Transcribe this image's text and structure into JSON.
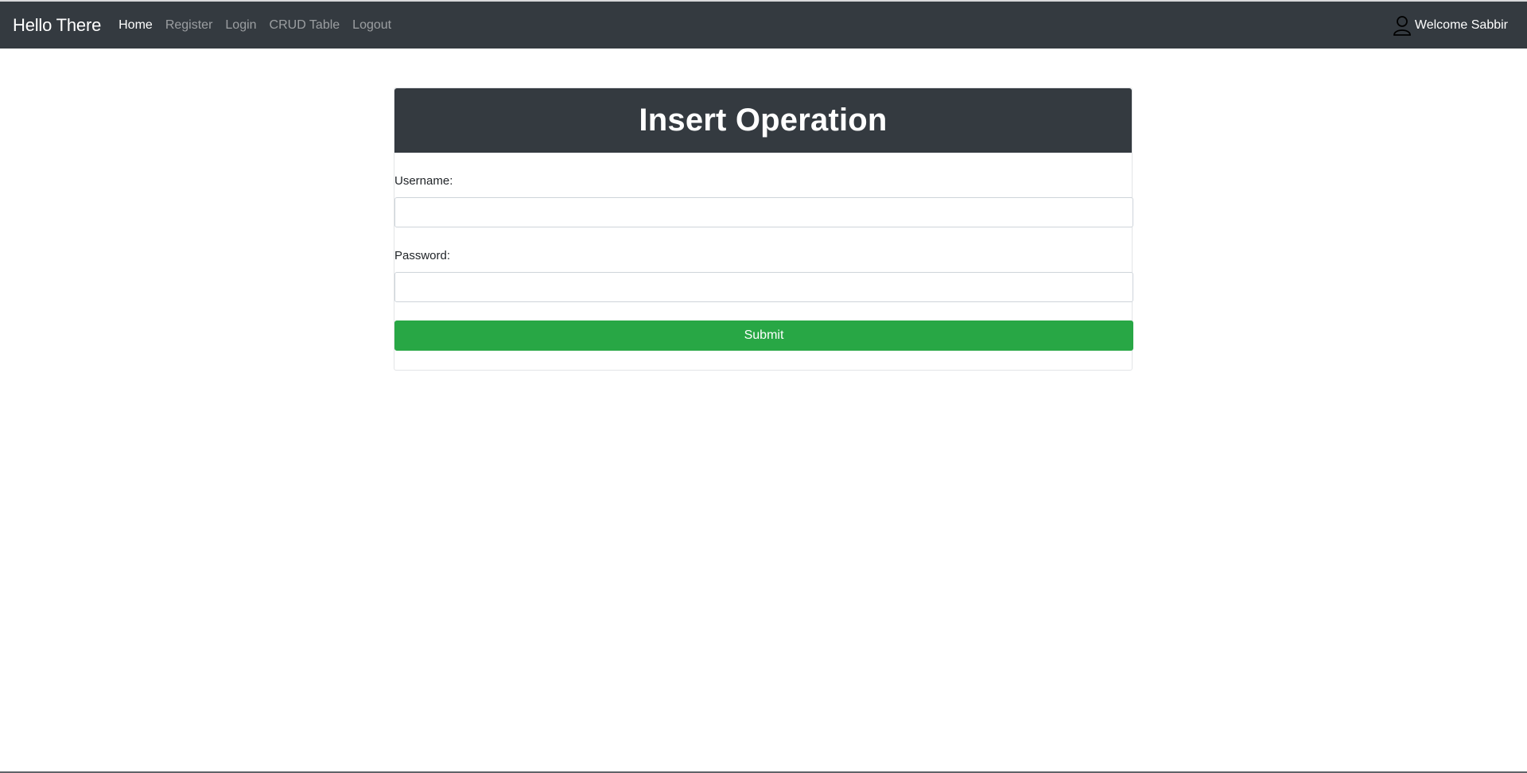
{
  "navbar": {
    "brand": "Hello There",
    "links": [
      {
        "label": "Home",
        "active": true
      },
      {
        "label": "Register",
        "active": false
      },
      {
        "label": "Login",
        "active": false
      },
      {
        "label": "CRUD Table",
        "active": false
      },
      {
        "label": "Logout",
        "active": false
      }
    ],
    "user_icon": "user-outline-icon",
    "welcome_text": "Welcome Sabbir"
  },
  "card": {
    "title": "Insert Operation",
    "username_label": "Username:",
    "username_value": "",
    "password_label": "Password:",
    "password_value": "",
    "submit_label": "Submit"
  },
  "colors": {
    "navbar_bg": "#343a40",
    "submit_bg": "#28a745"
  }
}
